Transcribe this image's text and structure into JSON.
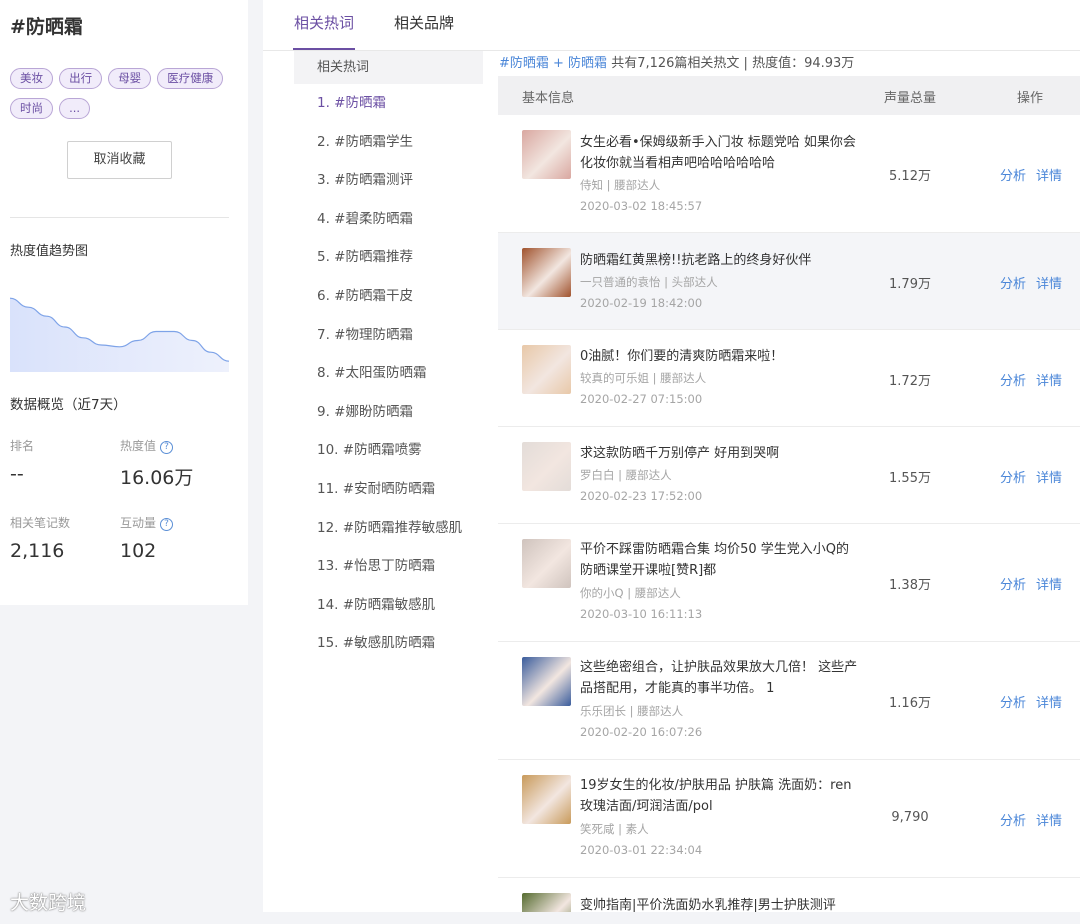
{
  "topic": {
    "title": "#防晒霜"
  },
  "tags": [
    "美妆",
    "出行",
    "母婴",
    "医疗健康",
    "时尚",
    "..."
  ],
  "cancel_button": "取消收藏",
  "trend": {
    "title": "热度值趋势图",
    "values": [
      82,
      72,
      62,
      50,
      38,
      30,
      28,
      35,
      45,
      45,
      35,
      22,
      12
    ]
  },
  "overview": {
    "title": "数据概览（近7天）",
    "rank_label": "排名",
    "rank_value": "--",
    "heat_label": "热度值",
    "heat_value": "16.06万",
    "notes_label": "相关笔记数",
    "notes_value": "2,116",
    "interact_label": "互动量",
    "interact_value": "102"
  },
  "tabs": [
    "相关热词",
    "相关品牌"
  ],
  "keywords": {
    "header": "相关热词",
    "items": [
      "1. #防晒霜",
      "2. #防晒霜学生",
      "3. #防晒霜测评",
      "4. #碧柔防晒霜",
      "5. #防晒霜推荐",
      "6. #防晒霜干皮",
      "7. #物理防晒霜",
      "8. #太阳蛋防晒霜",
      "9. #娜盼防晒霜",
      "10. #防晒霜喷雾",
      "11. #安耐晒防晒霜",
      "12. #防晒霜推荐敏感肌",
      "13. #怡思丁防晒霜",
      "14. #防晒霜敏感肌",
      "15. #敏感肌防晒霜"
    ]
  },
  "summary": {
    "link": "#防晒霜 + 防晒霜",
    "text": "共有7,126篇相关热文 | 热度值：94.93万"
  },
  "table": {
    "col_info": "基本信息",
    "col_volume": "声量总量",
    "col_action": "操作",
    "analyze": "分析",
    "detail": "详情",
    "rows": [
      {
        "title": "女生必看•保姆级新手入门妆 标题党哈 如果你会化妆你就当看相声吧哈哈哈哈哈哈",
        "author": "侍知  | 腰部达人",
        "time": "2020-03-02 18:45:57",
        "volume": "5.12万",
        "thumb_color": "#d9a7a0"
      },
      {
        "title": "防晒霜红黄黑榜!!抗老路上的终身好伙伴",
        "author": "一只普通的袁怡  | 头部达人",
        "time": "2020-02-19 18:42:00",
        "volume": "1.79万",
        "thumb_color": "#a0522d"
      },
      {
        "title": "0油腻！你们要的清爽防晒霜来啦！",
        "author": "较真的可乐姐 | 腰部达人",
        "time": "2020-02-27 07:15:00",
        "volume": "1.72万",
        "thumb_color": "#e8c8a8"
      },
      {
        "title": "求这款防晒千万别停产 好用到哭啊",
        "author": "罗白白 | 腰部达人",
        "time": "2020-02-23 17:52:00",
        "volume": "1.55万",
        "thumb_color": "#e3dcd8"
      },
      {
        "title": "平价不踩雷防晒霜合集  均价50 学生党入小Q的防晒课堂开课啦[赞R]都",
        "author": "你的小Q | 腰部达人",
        "time": "2020-03-10 16:11:13",
        "volume": "1.38万",
        "thumb_color": "#cfc3bd"
      },
      {
        "title": "这些绝密组合，让护肤品效果放大几倍！ 这些产品搭配用，才能真的事半功倍。 1",
        "author": "乐乐团长 | 腰部达人",
        "time": "2020-02-20 16:07:26",
        "volume": "1.16万",
        "thumb_color": "#3a5c9c"
      },
      {
        "title": "19岁女生的化妆/护肤用品 护肤篇 洗面奶：ren玫瑰洁面/珂润洁面/pol",
        "author": "笑死咸 | 素人",
        "time": "2020-03-01 22:34:04",
        "volume": "9,790",
        "thumb_color": "#c89a5a"
      },
      {
        "title": "变帅指南|平价洗面奶水乳推荐|男士护肤测评",
        "author": "",
        "time": "",
        "volume": "",
        "thumb_color": "#556b2f"
      }
    ]
  },
  "watermark": "大数跨境"
}
